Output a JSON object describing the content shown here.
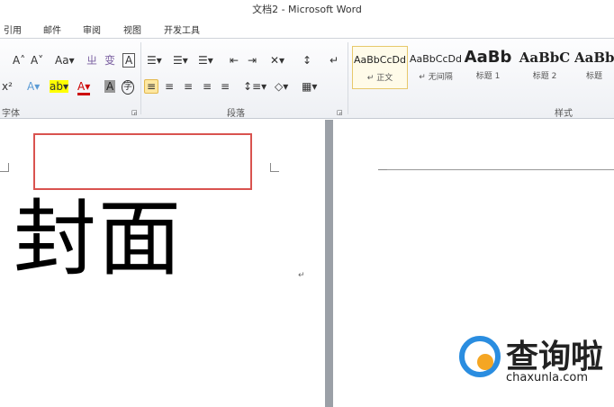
{
  "window": {
    "title": "文档2 - Microsoft Word"
  },
  "tabs": [
    "引用",
    "邮件",
    "审阅",
    "视图",
    "开发工具"
  ],
  "ribbon": {
    "groups": {
      "font": "字体",
      "paragraph": "段落",
      "styles": "样式"
    },
    "font_buttons": [
      "A˄",
      "A˅",
      "Aa▾",
      "ㄓ",
      "变",
      "A",
      "x²",
      "A▾",
      "ab▾",
      "A▾",
      "A",
      "字"
    ],
    "para_buttons_row1": [
      "☰▾",
      "☰▾",
      "☰▾",
      "⇤",
      "⇥",
      "✕▾",
      "↕",
      "↵"
    ],
    "para_buttons_row2": [
      "≡",
      "≡",
      "≡",
      "≡",
      "≡",
      "↕≡▾",
      "◇▾",
      "▦▾"
    ],
    "styles": [
      {
        "preview": "AaBbCcDd",
        "name": "↵ 正文"
      },
      {
        "preview": "AaBbCcDd",
        "name": "↵ 无间隔"
      },
      {
        "preview": "AaBb",
        "name": "标题 1"
      },
      {
        "preview": "AaBbC",
        "name": "标题 2"
      },
      {
        "preview": "AaBb",
        "name": "标题"
      }
    ]
  },
  "document": {
    "heading": "封面",
    "para_mark": "↵"
  },
  "watermark": {
    "cn": "查询啦",
    "en": "chaxunla.com"
  }
}
